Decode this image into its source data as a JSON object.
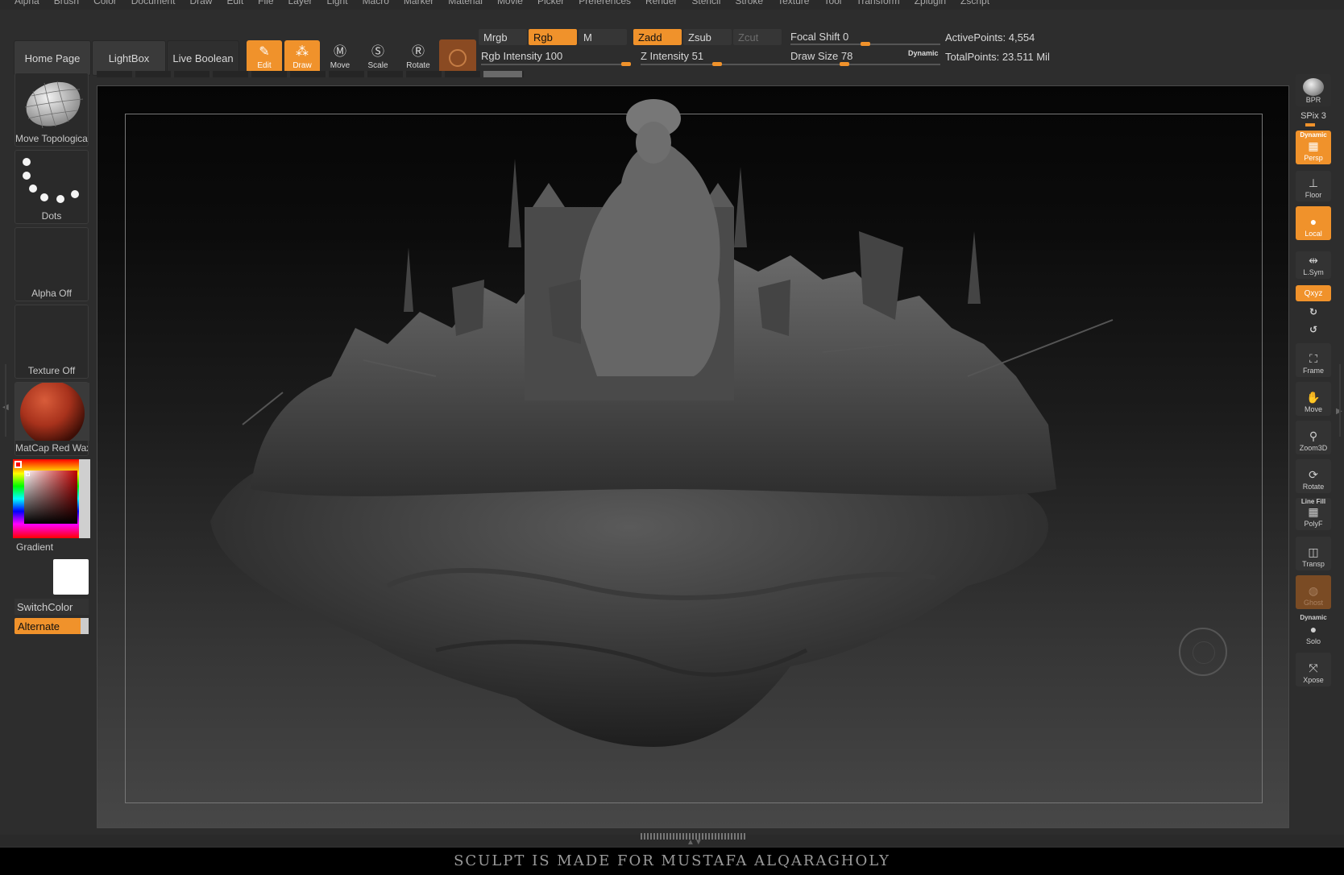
{
  "menu": [
    "Alpha",
    "Brush",
    "Color",
    "Document",
    "Draw",
    "Edit",
    "File",
    "Layer",
    "Light",
    "Macro",
    "Marker",
    "Material",
    "Movie",
    "Picker",
    "Preferences",
    "Render",
    "Stencil",
    "Stroke",
    "Texture",
    "Tool",
    "Transform",
    "Zplugin",
    "Zscript"
  ],
  "top_buttons": {
    "home_page": "Home Page",
    "lightbox": "LightBox",
    "live_boolean": "Live Boolean"
  },
  "tools": {
    "edit": "Edit",
    "draw": "Draw",
    "move": "Move",
    "scale": "Scale",
    "rotate": "Rotate"
  },
  "color_modes": {
    "mrgb": "Mrgb",
    "rgb": "Rgb",
    "m": "M",
    "zadd": "Zadd",
    "zsub": "Zsub",
    "zcut": "Zcut"
  },
  "sliders": {
    "rgb_intensity_label": "Rgb Intensity",
    "rgb_intensity_value": "100",
    "rgb_intensity_fraction": 1.0,
    "z_intensity_label": "Z Intensity",
    "z_intensity_value": "51",
    "z_intensity_fraction": 0.51,
    "focal_shift_label": "Focal Shift",
    "focal_shift_value": "0",
    "focal_shift_fraction": 0.5,
    "draw_size_label": "Draw Size",
    "draw_size_value": "78",
    "draw_size_fraction": 0.35,
    "dynamic_label": "Dynamic"
  },
  "stats": {
    "active_points": "ActivePoints: 4,554",
    "total_points": "TotalPoints: 23.511 Mil"
  },
  "left_shelf": {
    "brush": "Move Topological",
    "stroke": "Dots",
    "alpha": "Alpha Off",
    "texture": "Texture Off",
    "material": "MatCap Red Wax",
    "gradient": "Gradient",
    "switch_color": "SwitchColor",
    "alternate": "Alternate"
  },
  "right_shelf": {
    "bpr": "BPR",
    "spix": "SPix 3",
    "dynamic_top": "Dynamic",
    "persp": "Persp",
    "floor": "Floor",
    "local": "Local",
    "lsym": "L.Sym",
    "xyz": "Qxyz",
    "frame": "Frame",
    "move": "Move",
    "zoom3d": "Zoom3D",
    "rotate": "Rotate",
    "line_fill": "Line Fill",
    "polyf": "PolyF",
    "transp": "Transp",
    "ghost": "Ghost",
    "dynamic_solo": "Dynamic",
    "solo": "Solo",
    "xpose": "Xpose"
  },
  "caption": "SCULPT  IS MADE FOR MUSTAFA ALQARAGHOLY",
  "colors": {
    "accent": "#f0922b",
    "panel": "#2d2d2d",
    "material_red": "#a8321c"
  }
}
